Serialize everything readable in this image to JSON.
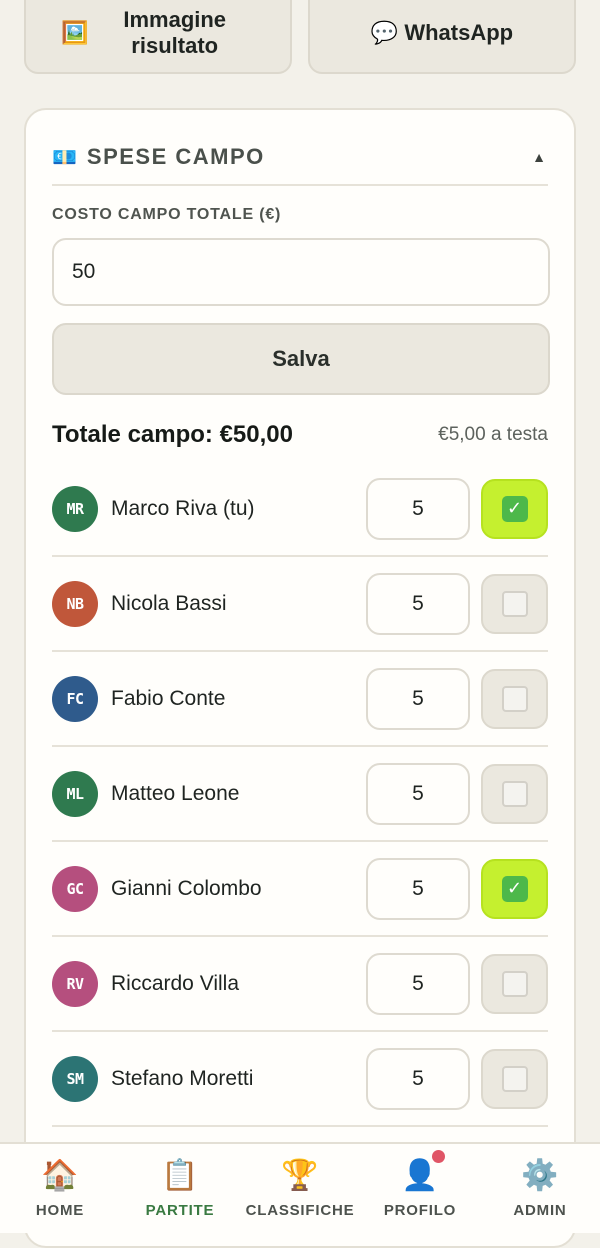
{
  "share": {
    "image_label": "Immagine risultato",
    "image_icon": "picture-icon",
    "whatsapp_label": "WhatsApp",
    "whatsapp_icon": "speech-bubble-icon"
  },
  "section": {
    "title": "SPESE CAMPO",
    "icon": "banknote-icon",
    "caret": "▲"
  },
  "cost": {
    "label": "COSTO CAMPO TOTALE (€)",
    "value": "50"
  },
  "save_label": "Salva",
  "summary": {
    "total": "Totale campo: €50,00",
    "per_person": "€5,00 a testa"
  },
  "players": [
    {
      "initials": "MR",
      "name": "Marco Riva (tu)",
      "amount": "5",
      "paid": true,
      "color": "#2f7a4f"
    },
    {
      "initials": "NB",
      "name": "Nicola Bassi",
      "amount": "5",
      "paid": false,
      "color": "#c0573a"
    },
    {
      "initials": "FC",
      "name": "Fabio Conte",
      "amount": "5",
      "paid": false,
      "color": "#2f5b8c"
    },
    {
      "initials": "ML",
      "name": "Matteo Leone",
      "amount": "5",
      "paid": false,
      "color": "#2f7a4f"
    },
    {
      "initials": "GC",
      "name": "Gianni Colombo",
      "amount": "5",
      "paid": true,
      "color": "#b54f7e"
    },
    {
      "initials": "RV",
      "name": "Riccardo Villa",
      "amount": "5",
      "paid": false,
      "color": "#b54f7e"
    },
    {
      "initials": "SM",
      "name": "Stefano Moretti",
      "amount": "5",
      "paid": false,
      "color": "#2c7474"
    }
  ],
  "nav": [
    {
      "label": "HOME",
      "icon": "house-icon",
      "glyph": "🏠",
      "active": false
    },
    {
      "label": "PARTITE",
      "icon": "clipboard-icon",
      "glyph": "📋",
      "active": true
    },
    {
      "label": "CLASSIFICHE",
      "icon": "trophy-icon",
      "glyph": "🏆",
      "active": false
    },
    {
      "label": "PROFILO",
      "icon": "user-icon",
      "glyph": "👤",
      "active": false,
      "notification": true
    },
    {
      "label": "ADMIN",
      "icon": "gear-icon",
      "glyph": "⚙️",
      "active": false
    }
  ],
  "colors": {
    "paid_on": "#c5f02f",
    "accent_nav": "#3a7a42",
    "notification": "#e05566"
  }
}
